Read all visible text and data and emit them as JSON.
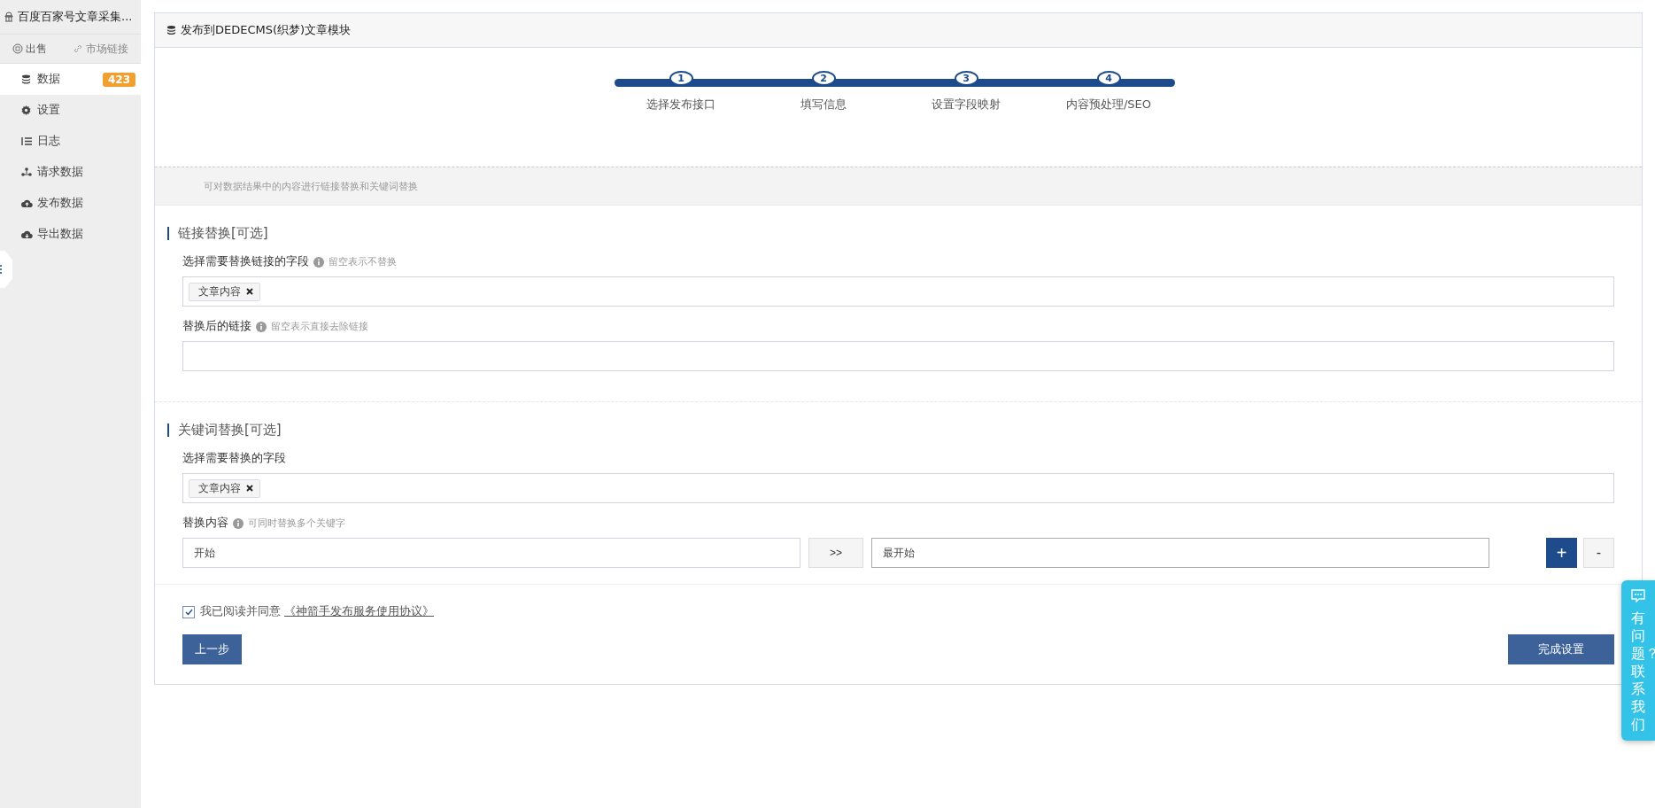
{
  "sidebar": {
    "title": "百度百家号文章采集...",
    "actions": [
      {
        "label": "出售"
      },
      {
        "label": "市场链接"
      }
    ],
    "items": [
      {
        "label": "数据",
        "badge": "423",
        "selected": true
      },
      {
        "label": "设置",
        "selected": false
      },
      {
        "label": "日志",
        "selected": false
      },
      {
        "label": "请求数据",
        "selected": false
      },
      {
        "label": "发布数据",
        "selected": false
      },
      {
        "label": "导出数据",
        "selected": false
      }
    ]
  },
  "panel": {
    "title": "发布到DEDECMS(织梦)文章模块",
    "steps": [
      {
        "number": "1",
        "label": "选择发布接口"
      },
      {
        "number": "2",
        "label": "填写信息"
      },
      {
        "number": "3",
        "label": "设置字段映射"
      },
      {
        "number": "4",
        "label": "内容预处理/SEO"
      }
    ],
    "notice": "可对数据结果中的内容进行链接替换和关键词替换",
    "sections": [
      {
        "title": "链接替换[可选]",
        "fields": [
          {
            "kind": "tags",
            "label": "选择需要替换链接的字段",
            "hint": "留空表示不替换",
            "tags": [
              "文章内容"
            ]
          },
          {
            "kind": "text",
            "label": "替换后的链接",
            "hint": "留空表示直接去除链接"
          }
        ]
      },
      {
        "title": "关键词替换[可选]",
        "fields": [
          {
            "kind": "tags",
            "label": "选择需要替换的字段",
            "tags": [
              "文章内容"
            ]
          },
          {
            "kind": "pair",
            "label": "替换内容",
            "hint": "可同时替换多个关键字",
            "from": "开始",
            "arrow": ">>",
            "to": "最开始",
            "add": "+",
            "remove": "-"
          }
        ]
      }
    ],
    "agreement": {
      "checked": true,
      "text": "我已阅读并同意",
      "link": "《神箭手发布服务使用协议》"
    },
    "buttons": {
      "previous": "上一步",
      "finish": "完成设置"
    }
  },
  "chat": {
    "label": "有问题？联系我们"
  }
}
